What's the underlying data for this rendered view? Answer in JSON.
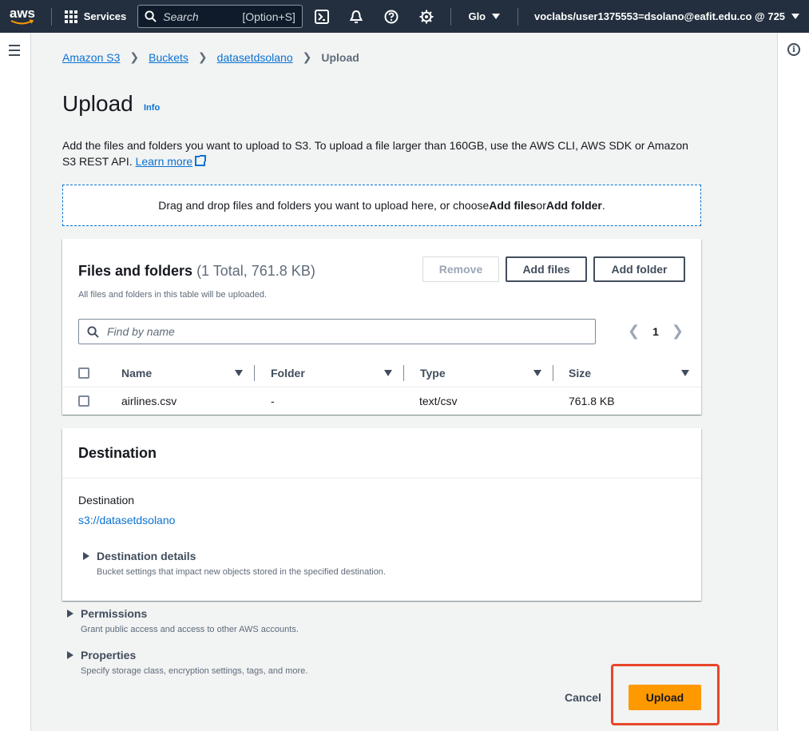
{
  "topnav": {
    "logo_text": "aws",
    "services_label": "Services",
    "search_placeholder": "Search",
    "search_shortcut": "[Option+S]",
    "region_label": "Glo",
    "account_label": "voclabs/user1375553=dsolano@eafit.edu.co @ 725"
  },
  "breadcrumb": {
    "items": [
      "Amazon S3",
      "Buckets",
      "datasetdsolano"
    ],
    "current": "Upload"
  },
  "page": {
    "title": "Upload",
    "info_label": "Info",
    "description": "Add the files and folders you want to upload to S3. To upload a file larger than 160GB, use the AWS CLI, AWS SDK or Amazon S3 REST API.",
    "learn_more": "Learn more"
  },
  "dropzone": {
    "prefix": "Drag and drop files and folders you want to upload here, or choose ",
    "add_files": "Add files",
    "or": " or ",
    "add_folder": "Add folder",
    "suffix": "."
  },
  "files_panel": {
    "title": "Files and folders",
    "count": "(1 Total, 761.8 KB)",
    "subtitle": "All files and folders in this table will be uploaded.",
    "remove_label": "Remove",
    "add_files_label": "Add files",
    "add_folder_label": "Add folder",
    "find_placeholder": "Find by name",
    "page_number": "1",
    "columns": [
      "Name",
      "Folder",
      "Type",
      "Size"
    ],
    "rows": [
      {
        "name": "airlines.csv",
        "folder": "-",
        "type": "text/csv",
        "size": "761.8 KB"
      }
    ]
  },
  "destination": {
    "title": "Destination",
    "label": "Destination",
    "value": "s3://datasetdsolano",
    "details_title": "Destination details",
    "details_sub": "Bucket settings that impact new objects stored in the specified destination."
  },
  "permissions": {
    "title": "Permissions",
    "sub": "Grant public access and access to other AWS accounts."
  },
  "properties": {
    "title": "Properties",
    "sub": "Specify storage class, encryption settings, tags, and more."
  },
  "actions": {
    "cancel_label": "Cancel",
    "upload_label": "Upload"
  },
  "colors": {
    "nav_bg": "#232f3e",
    "link": "#0972d3",
    "primary_button": "#ff9900",
    "highlight": "#e8462c"
  }
}
